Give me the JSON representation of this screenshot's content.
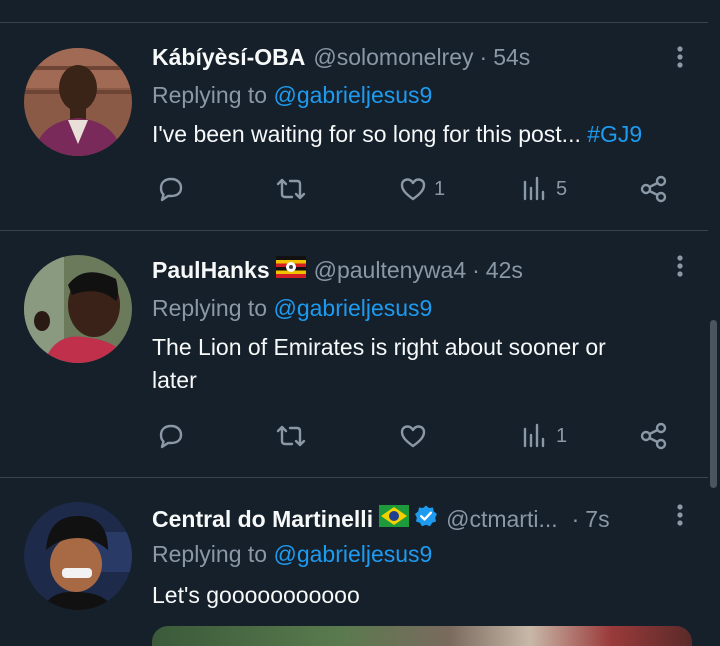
{
  "tweets": [
    {
      "name": "Kábíyèsí-OBA",
      "handle": "@solomonelrey",
      "dot": "·",
      "time": "54s",
      "replying_prefix": "Replying to ",
      "replying_to": "@gabrieljesus9",
      "text": "I've been waiting for so long for this post... ",
      "hashtag": "#GJ9",
      "likes": "1",
      "views": "5"
    },
    {
      "name": "PaulHanks",
      "handle": "@paultenywa4",
      "dot": "·",
      "time": "42s",
      "replying_prefix": "Replying to ",
      "replying_to": "@gabrieljesus9",
      "text_line1": "The Lion of Emirates is right about sooner or",
      "text_line2": "later",
      "likes": "",
      "views": "1"
    },
    {
      "name": "Central do Martinelli",
      "handle": "@ctmarti...",
      "dot": "·",
      "time": "7s",
      "replying_prefix": "Replying to ",
      "replying_to": "@gabrieljesus9",
      "text": "Let's gooooooooooo"
    }
  ],
  "icons": {
    "reply": "reply-icon",
    "retweet": "retweet-icon",
    "like": "like-icon",
    "views": "views-icon",
    "share": "share-icon",
    "more": "more-icon"
  },
  "colors": {
    "background": "#15202b",
    "text": "#f7f9f9",
    "muted": "#8b98a5",
    "accent": "#1d9bf0",
    "divider": "#38444d"
  }
}
